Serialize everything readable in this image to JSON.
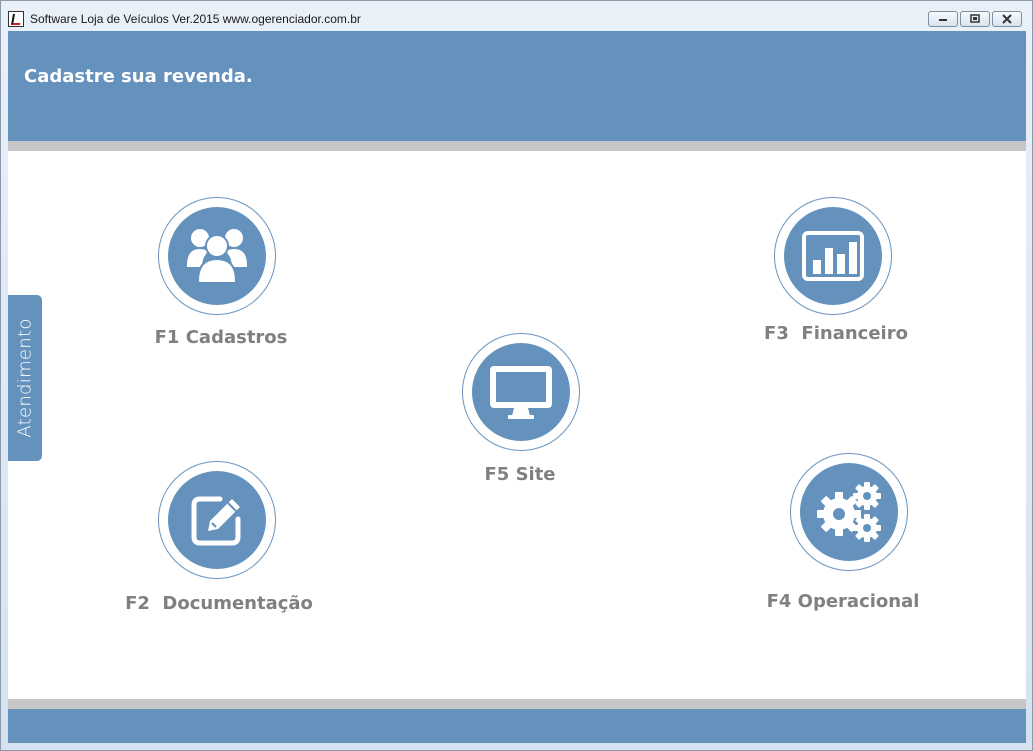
{
  "window": {
    "title": "Software Loja de Veículos  Ver.2015 www.ogerenciador.com.br",
    "minimize_glyph": "▭",
    "maximize_glyph": "▣",
    "close_glyph": "✕"
  },
  "header": {
    "title": "Cadastre sua revenda."
  },
  "side_tab": {
    "label": "Atendimento"
  },
  "modules": {
    "cadastros": {
      "label": "F1 Cadastros",
      "icon": "users-icon"
    },
    "documentacao": {
      "label": "F2  Documentação",
      "icon": "edit-icon"
    },
    "financeiro": {
      "label": "F3  Financeiro",
      "icon": "bar-chart-icon"
    },
    "operacional": {
      "label": "F4 Operacional",
      "icon": "gears-icon"
    },
    "site": {
      "label": "F5 Site",
      "icon": "monitor-icon"
    }
  },
  "colors": {
    "accent": "#6492bc",
    "separator": "#c6c6c8",
    "label": "#808080"
  }
}
